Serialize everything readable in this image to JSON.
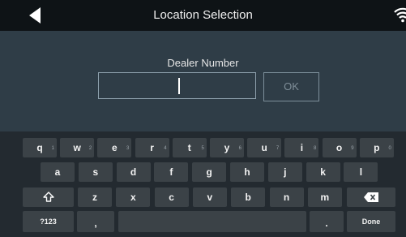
{
  "header": {
    "title": "Location Selection",
    "back_icon": "back-arrow-icon",
    "status_icon": "wifi-icon"
  },
  "form": {
    "label": "Dealer Number",
    "input_value": "",
    "ok_label": "OK"
  },
  "keyboard": {
    "row1": [
      {
        "label": "q",
        "hint": "1"
      },
      {
        "label": "w",
        "hint": "2"
      },
      {
        "label": "e",
        "hint": "3"
      },
      {
        "label": "r",
        "hint": "4"
      },
      {
        "label": "t",
        "hint": "5"
      },
      {
        "label": "y",
        "hint": "6"
      },
      {
        "label": "u",
        "hint": "7"
      },
      {
        "label": "i",
        "hint": "8"
      },
      {
        "label": "o",
        "hint": "9"
      },
      {
        "label": "p",
        "hint": "0"
      }
    ],
    "row2": [
      "a",
      "s",
      "d",
      "f",
      "g",
      "h",
      "j",
      "k",
      "l"
    ],
    "row3": [
      "z",
      "x",
      "c",
      "v",
      "b",
      "n",
      "m"
    ],
    "symbols_label": "?123",
    "comma_label": ",",
    "period_label": ".",
    "done_label": "Done",
    "shift_icon": "shift-icon",
    "backspace_icon": "backspace-icon"
  },
  "colors": {
    "header_bg": "#0e1316",
    "form_bg": "#2f3d47",
    "keyboard_bg": "#232a30",
    "key_bg": "#3b4247"
  }
}
